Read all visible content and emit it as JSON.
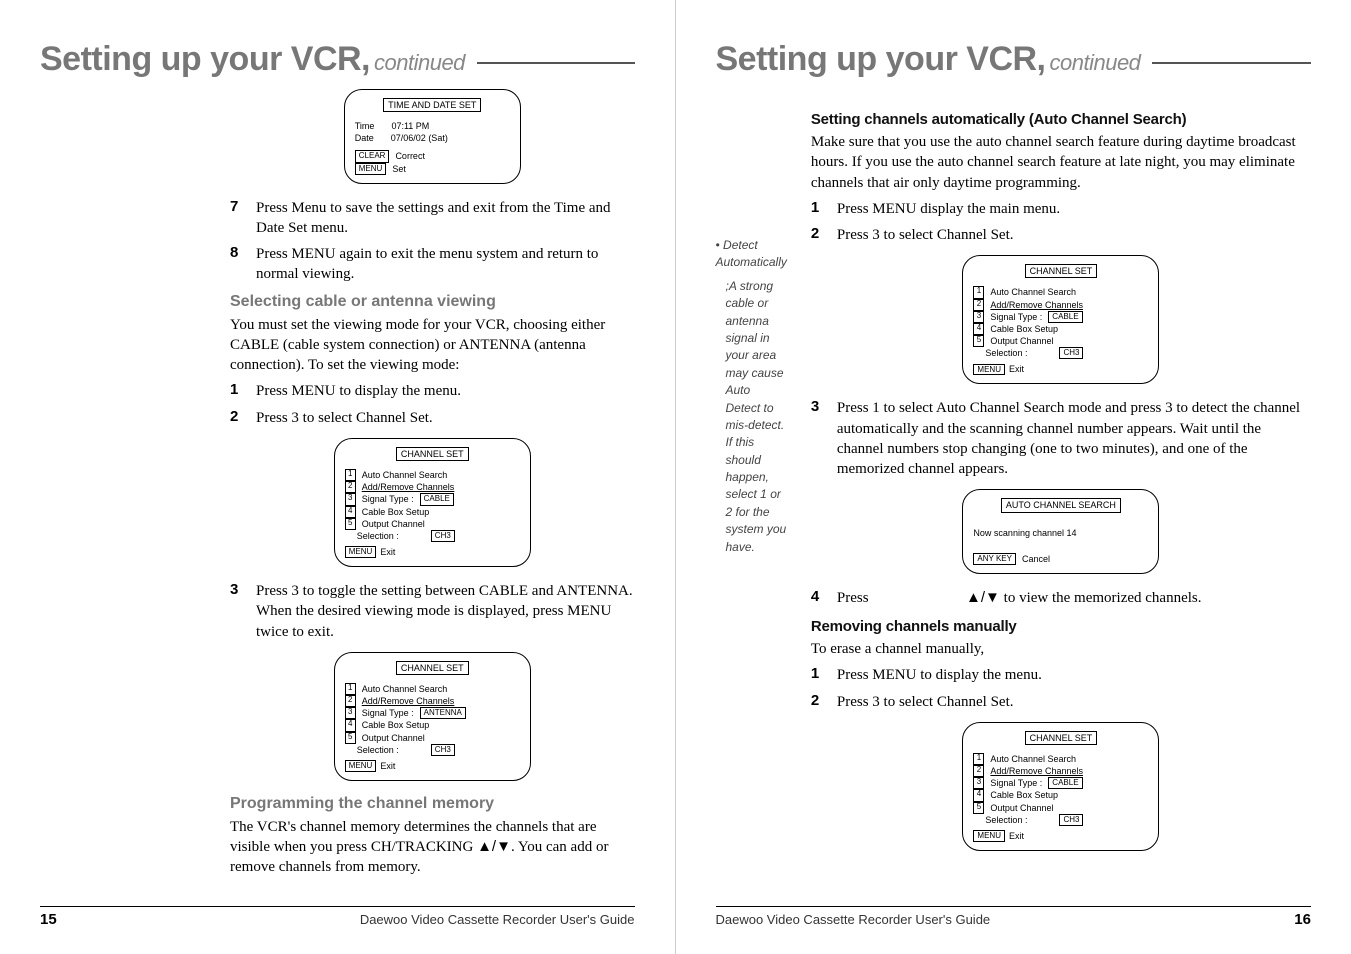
{
  "left": {
    "title": "Setting up your VCR,",
    "continued": "continued",
    "osd1": {
      "title": "TIME AND DATE SET",
      "time_label": "Time",
      "time_value": "07:11 PM",
      "date_label": "Date",
      "date_value": "07/06/02 (Sat)",
      "clear_label": "CLEAR",
      "clear_text": "Correct",
      "menu_label": "MENU",
      "menu_text": "Set"
    },
    "step7_num": "7",
    "step7": "Press Menu to save the settings and exit from the Time and Date Set menu.",
    "step8_num": "8",
    "step8": "Press MENU again to exit the menu system and return to normal viewing.",
    "sel_head": "Selecting cable or antenna viewing",
    "sel_para": "You must set the viewing mode for your VCR, choosing either CABLE (cable system connection) or ANTENNA (antenna connection). To set the viewing mode:",
    "sel_step1_num": "1",
    "sel_step1": "Press MENU to display the menu.",
    "sel_step2_num": "2",
    "sel_step2": "Press 3 to select  Channel Set.",
    "osd_channel": {
      "title": "CHANNEL SET",
      "items": [
        {
          "n": "1",
          "label": "Auto Channel Search"
        },
        {
          "n": "2",
          "label": "Add/Remove Channels"
        },
        {
          "n": "3",
          "label": "Signal Type   :",
          "value": "CABLE"
        },
        {
          "n": "4",
          "label": "Cable Box Setup"
        },
        {
          "n": "5",
          "label": "Output Channel"
        }
      ],
      "selection_label": "Selection :",
      "selection_value": "CH3",
      "menu_label": "MENU",
      "exit": "Exit"
    },
    "sel_step3_num": "3",
    "sel_step3": "Press 3 to toggle the setting between CABLE and ANTENNA. When the desired viewing mode is displayed, press MENU twice to exit.",
    "osd_channel2_signal_value": "ANTENNA",
    "prog_head": "Programming the channel memory",
    "prog_para_a": "The VCR's channel memory determines the channels that are  visible when you press CH/TRACKING ",
    "prog_arrows": "▲/▼",
    "prog_para_b": ". You can add or remove channels from memory.",
    "footer_page": "15",
    "footer_src": "Daewoo Video Cassette Recorder User's Guide"
  },
  "right": {
    "title": "Setting up your VCR,",
    "continued": "continued",
    "margin_head": "• Detect Automatically",
    "margin_body": ";A strong cable or antenna signal in your area may cause Auto Detect to mis-detect. If this should happen, select 1 or 2 for the system you have.",
    "auto_head": "Setting channels automatically (Auto Channel Search)",
    "auto_para": "Make sure that you use the auto channel search feature during daytime broadcast hours. If you use the auto channel search feature at late night, you may eliminate channels that air only daytime programming.",
    "auto_step1_num": "1",
    "auto_step1": "Press MENU display the main menu.",
    "auto_step2_num": "2",
    "auto_step2": "Press 3 to select Channel Set.",
    "auto_step3_num": "3",
    "auto_step3": "Press 1 to select Auto Channel Search mode and press 3 to detect the channel automatically and the scanning channel number appears. Wait until the channel numbers stop changing (one to two minutes), and one of the memorized channel appears.",
    "osd_scan": {
      "title": "AUTO CHANNEL SEARCH",
      "body": "Now scanning channel 14",
      "anykey_label": "ANY KEY",
      "anykey_text": "Cancel"
    },
    "auto_step4_num": "4",
    "auto_step4_a": "Press",
    "auto_step4_arrows": "▲/▼",
    "auto_step4_b": " to view the memorized channels.",
    "remove_head": "Removing channels manually",
    "remove_intro": "To erase a channel manually,",
    "remove_step1_num": "1",
    "remove_step1": "Press MENU to display the menu.",
    "remove_step2_num": "2",
    "remove_step2": "Press 3 to select Channel Set.",
    "footer_page": "16",
    "footer_src": "Daewoo Video Cassette Recorder User's Guide"
  }
}
